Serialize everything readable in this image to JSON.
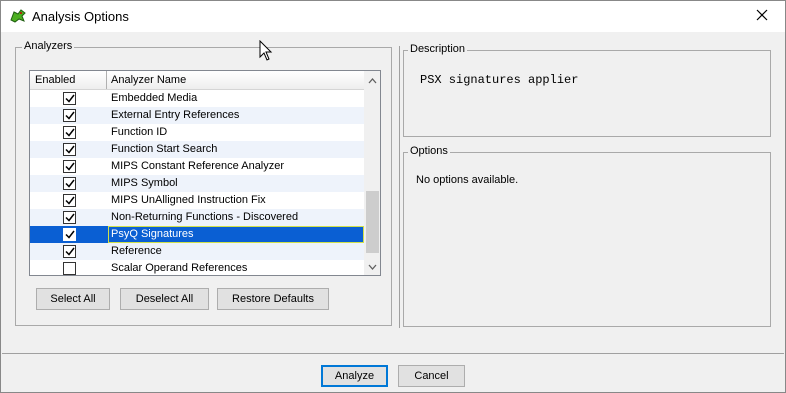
{
  "window": {
    "title": "Analysis Options",
    "icon": "dragon-app-icon",
    "close_icon": "close-icon"
  },
  "analyzers": {
    "legend": "Analyzers",
    "columns": {
      "enabled": "Enabled",
      "name": "Analyzer Name"
    },
    "rows": [
      {
        "name": "Embedded Media",
        "checked": true
      },
      {
        "name": "External Entry References",
        "checked": true
      },
      {
        "name": "Function ID",
        "checked": true
      },
      {
        "name": "Function Start Search",
        "checked": true
      },
      {
        "name": "MIPS Constant Reference Analyzer",
        "checked": true
      },
      {
        "name": "MIPS Symbol",
        "checked": true
      },
      {
        "name": "MIPS UnAlligned Instruction Fix",
        "checked": true
      },
      {
        "name": "Non-Returning Functions - Discovered",
        "checked": true
      },
      {
        "name": "PsyQ Signatures",
        "checked": true,
        "selected": true
      },
      {
        "name": "Reference",
        "checked": true
      },
      {
        "name": "Scalar Operand References",
        "checked": false
      }
    ],
    "buttons": {
      "select_all": "Select All",
      "deselect_all": "Deselect All",
      "restore_defaults": "Restore Defaults"
    }
  },
  "description": {
    "legend": "Description",
    "text": "PSX signatures applier"
  },
  "options": {
    "legend": "Options",
    "text": "No options available."
  },
  "footer": {
    "analyze": "Analyze",
    "cancel": "Cancel"
  },
  "colors": {
    "selection": "#0a5fd3",
    "alt_row": "#eef3fb",
    "focus_border": "#0078d7"
  }
}
